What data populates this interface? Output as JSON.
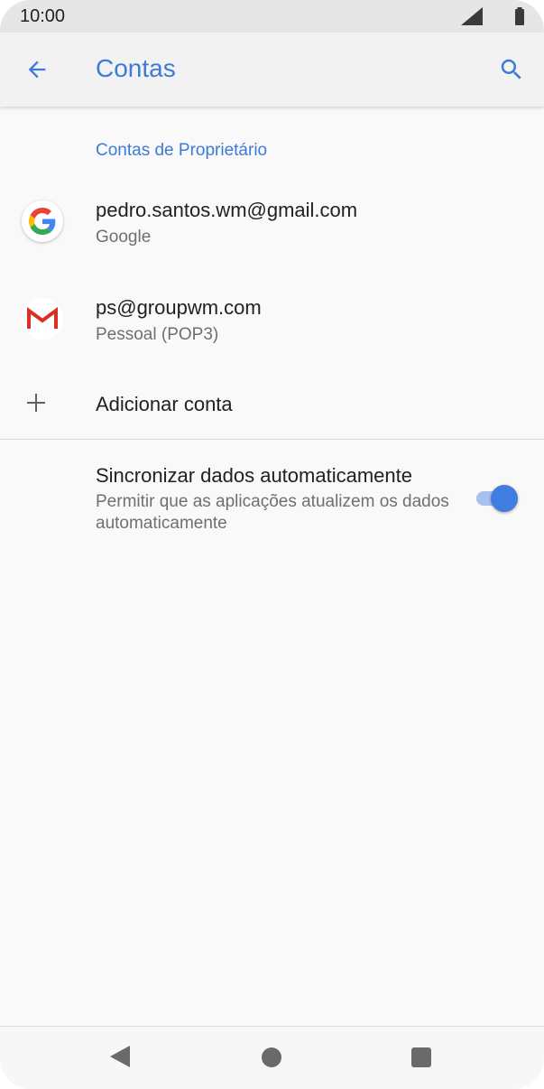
{
  "status_bar": {
    "time": "10:00"
  },
  "toolbar": {
    "title": "Contas",
    "back_icon": "arrow-back-icon",
    "search_icon": "search-icon"
  },
  "section": {
    "header": "Contas de Proprietário"
  },
  "accounts": [
    {
      "title": "pedro.santos.wm@gmail.com",
      "subtitle": "Google",
      "icon": "google-icon"
    },
    {
      "title": "ps@groupwm.com",
      "subtitle": "Pessoal (POP3)",
      "icon": "gmail-icon"
    }
  ],
  "add_account": {
    "label": "Adicionar conta",
    "icon": "plus-icon"
  },
  "sync": {
    "title": "Sincronizar dados automaticamente",
    "description": "Permitir que as aplicações atualizem os dados automaticamente",
    "enabled": true
  },
  "colors": {
    "accent": "#3d7ad9",
    "toggle_thumb": "#3f7ee0",
    "toggle_track": "#a8c2ee"
  }
}
